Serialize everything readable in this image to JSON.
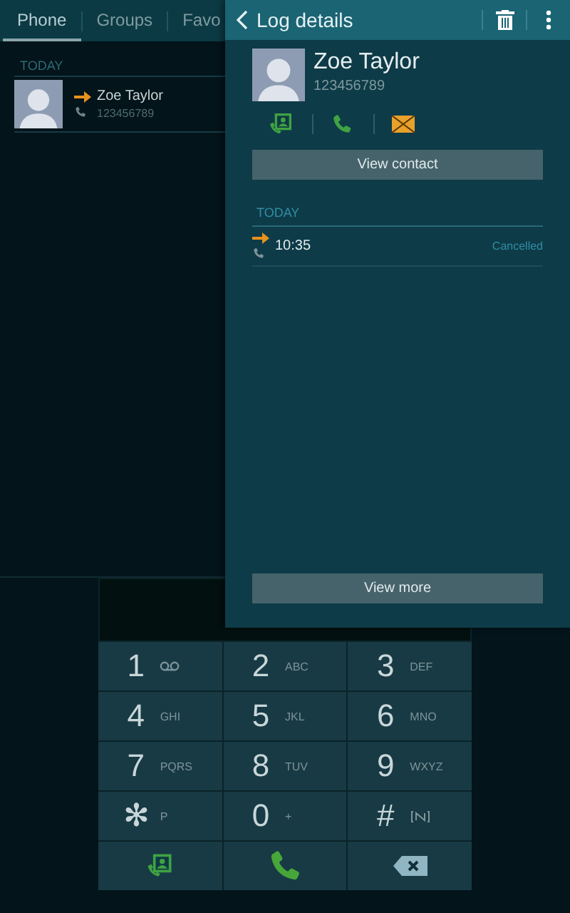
{
  "tabs": [
    {
      "label": "Phone",
      "selected": true
    },
    {
      "label": "Groups",
      "selected": false
    },
    {
      "label": "Favo",
      "selected": false
    }
  ],
  "log": {
    "section": "TODAY",
    "entries": [
      {
        "name": "Zoe Taylor",
        "number": "123456789"
      }
    ]
  },
  "details": {
    "title": "Log details",
    "name": "Zoe Taylor",
    "number": "123456789",
    "view_contact": "View contact",
    "section": "TODAY",
    "calls": [
      {
        "time": "10:35",
        "status": "Cancelled"
      }
    ],
    "view_more": "View more"
  },
  "keypad": [
    {
      "kind": "voicemail",
      "digit": "1"
    },
    {
      "kind": "digit",
      "digit": "2",
      "letters": "ABC"
    },
    {
      "kind": "digit",
      "digit": "3",
      "letters": "DEF"
    },
    {
      "kind": "digit",
      "digit": "4",
      "letters": "GHI"
    },
    {
      "kind": "digit",
      "digit": "5",
      "letters": "JKL"
    },
    {
      "kind": "digit",
      "digit": "6",
      "letters": "MNO"
    },
    {
      "kind": "digit",
      "digit": "7",
      "letters": "PQRS"
    },
    {
      "kind": "digit",
      "digit": "8",
      "letters": "TUV"
    },
    {
      "kind": "digit",
      "digit": "9",
      "letters": "WXYZ"
    },
    {
      "kind": "digit",
      "digit": "✻",
      "letters": "P"
    },
    {
      "kind": "digit",
      "digit": "0",
      "letters": "+"
    },
    {
      "kind": "pause",
      "digit": "#"
    },
    {
      "kind": "contacts"
    },
    {
      "kind": "call"
    },
    {
      "kind": "backspace"
    }
  ]
}
